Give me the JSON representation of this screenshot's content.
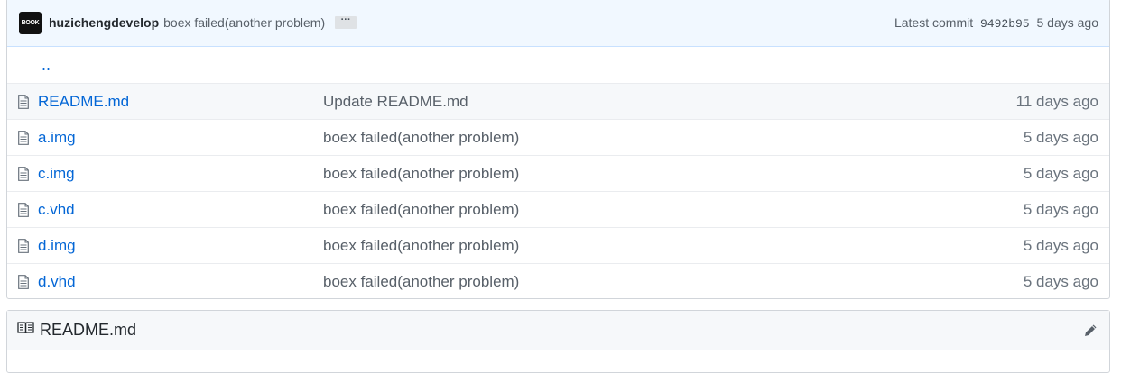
{
  "commit_bar": {
    "avatar_text": "BOOK",
    "author": "huzichengdevelop",
    "message": "boex failed(another problem)",
    "ellipsis": "···",
    "latest_label": "Latest commit",
    "sha": "9492b95",
    "age": "5 days ago"
  },
  "up_dir": "..",
  "files": [
    {
      "name": "README.md",
      "message": "Update README.md",
      "age": "11 days ago",
      "icon": "file-icon"
    },
    {
      "name": "a.img",
      "message": "boex failed(another problem)",
      "age": "5 days ago",
      "icon": "file-icon"
    },
    {
      "name": "c.img",
      "message": "boex failed(another problem)",
      "age": "5 days ago",
      "icon": "file-icon"
    },
    {
      "name": "c.vhd",
      "message": "boex failed(another problem)",
      "age": "5 days ago",
      "icon": "file-icon"
    },
    {
      "name": "d.img",
      "message": "boex failed(another problem)",
      "age": "5 days ago",
      "icon": "file-icon"
    },
    {
      "name": "d.vhd",
      "message": "boex failed(another problem)",
      "age": "5 days ago",
      "icon": "file-icon"
    }
  ],
  "readme": {
    "title": "README.md",
    "icon": "book-icon",
    "edit_icon": "pencil-icon"
  },
  "colors": {
    "link": "#0366d6",
    "commit_bar_bg": "#f1f8ff",
    "muted_text": "#586069"
  }
}
